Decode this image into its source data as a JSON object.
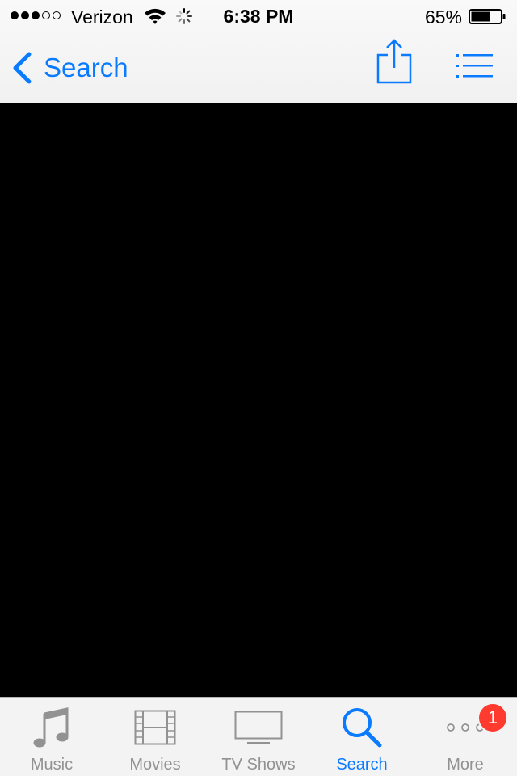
{
  "status_bar": {
    "carrier": "Verizon",
    "signal_bars_filled": 3,
    "signal_bars_total": 5,
    "time": "6:38 PM",
    "battery_percent": "65%",
    "battery_level": 0.65
  },
  "nav_bar": {
    "back_label": "Search",
    "share_icon": "share-icon",
    "list_icon": "list-icon"
  },
  "content": {
    "background": "#000000"
  },
  "tab_bar": {
    "tabs": [
      {
        "label": "Music",
        "icon": "music-note-icon",
        "active": false
      },
      {
        "label": "Movies",
        "icon": "film-strip-icon",
        "active": false
      },
      {
        "label": "TV Shows",
        "icon": "tv-icon",
        "active": false
      },
      {
        "label": "Search",
        "icon": "search-icon",
        "active": true
      },
      {
        "label": "More",
        "icon": "more-icon",
        "active": false
      }
    ],
    "more_badge": "1"
  },
  "colors": {
    "accent": "#0a7aff",
    "inactive": "#929292",
    "badge": "#ff3b30"
  }
}
